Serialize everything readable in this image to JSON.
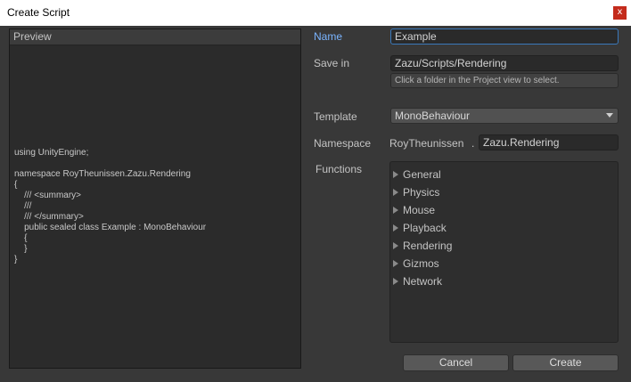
{
  "window": {
    "title": "Create Script",
    "close_glyph": "x"
  },
  "preview": {
    "header": "Preview",
    "code": "using UnityEngine;\n\nnamespace RoyTheunissen.Zazu.Rendering\n{\n    /// <summary>\n    ///\n    /// </summary>\n    public sealed class Example : MonoBehaviour\n    {\n    }\n}"
  },
  "form": {
    "name_label": "Name",
    "name_value": "Example",
    "save_in_label": "Save in",
    "save_in_value": "Zazu/Scripts/Rendering",
    "save_in_hint": "Click a folder in the Project view to select.",
    "template_label": "Template",
    "template_value": "MonoBehaviour",
    "namespace_label": "Namespace",
    "namespace_prefix": "RoyTheunissen",
    "namespace_separator": ".",
    "namespace_value": "Zazu.Rendering",
    "functions_label": "Functions",
    "functions": [
      "General",
      "Physics",
      "Mouse",
      "Playback",
      "Rendering",
      "Gizmos",
      "Network"
    ]
  },
  "buttons": {
    "cancel": "Cancel",
    "create": "Create"
  },
  "colors": {
    "background": "#383838",
    "active_label": "#7ab4ff",
    "close_button": "#c42b1c",
    "focus_border": "#3a79bb"
  }
}
